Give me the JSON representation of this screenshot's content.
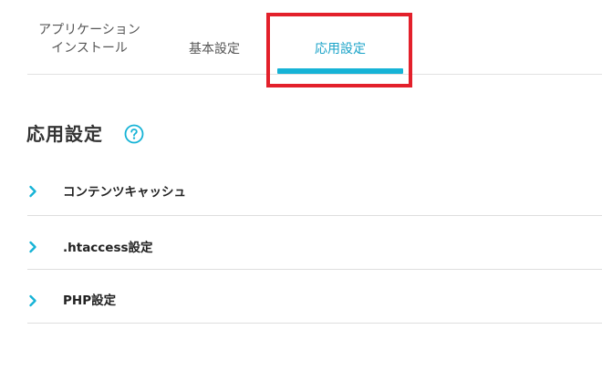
{
  "tabs": {
    "install_line1": "アプリケーション",
    "install_line2": "インストール",
    "basic": "基本設定",
    "advanced": "応用設定"
  },
  "section": {
    "title": "応用設定",
    "help_icon": "question-circle-icon"
  },
  "accordion": {
    "items": [
      {
        "label": "コンテンツキャッシュ",
        "icon": "chevron-right-icon"
      },
      {
        "label": ".htaccess設定",
        "icon": "chevron-right-icon"
      },
      {
        "label": "PHP設定",
        "icon": "chevron-right-icon"
      }
    ]
  },
  "colors": {
    "accent": "#16b3d6",
    "active_tab_text": "#1aa3c8",
    "highlight": "#e3202b",
    "divider": "#dedede"
  }
}
